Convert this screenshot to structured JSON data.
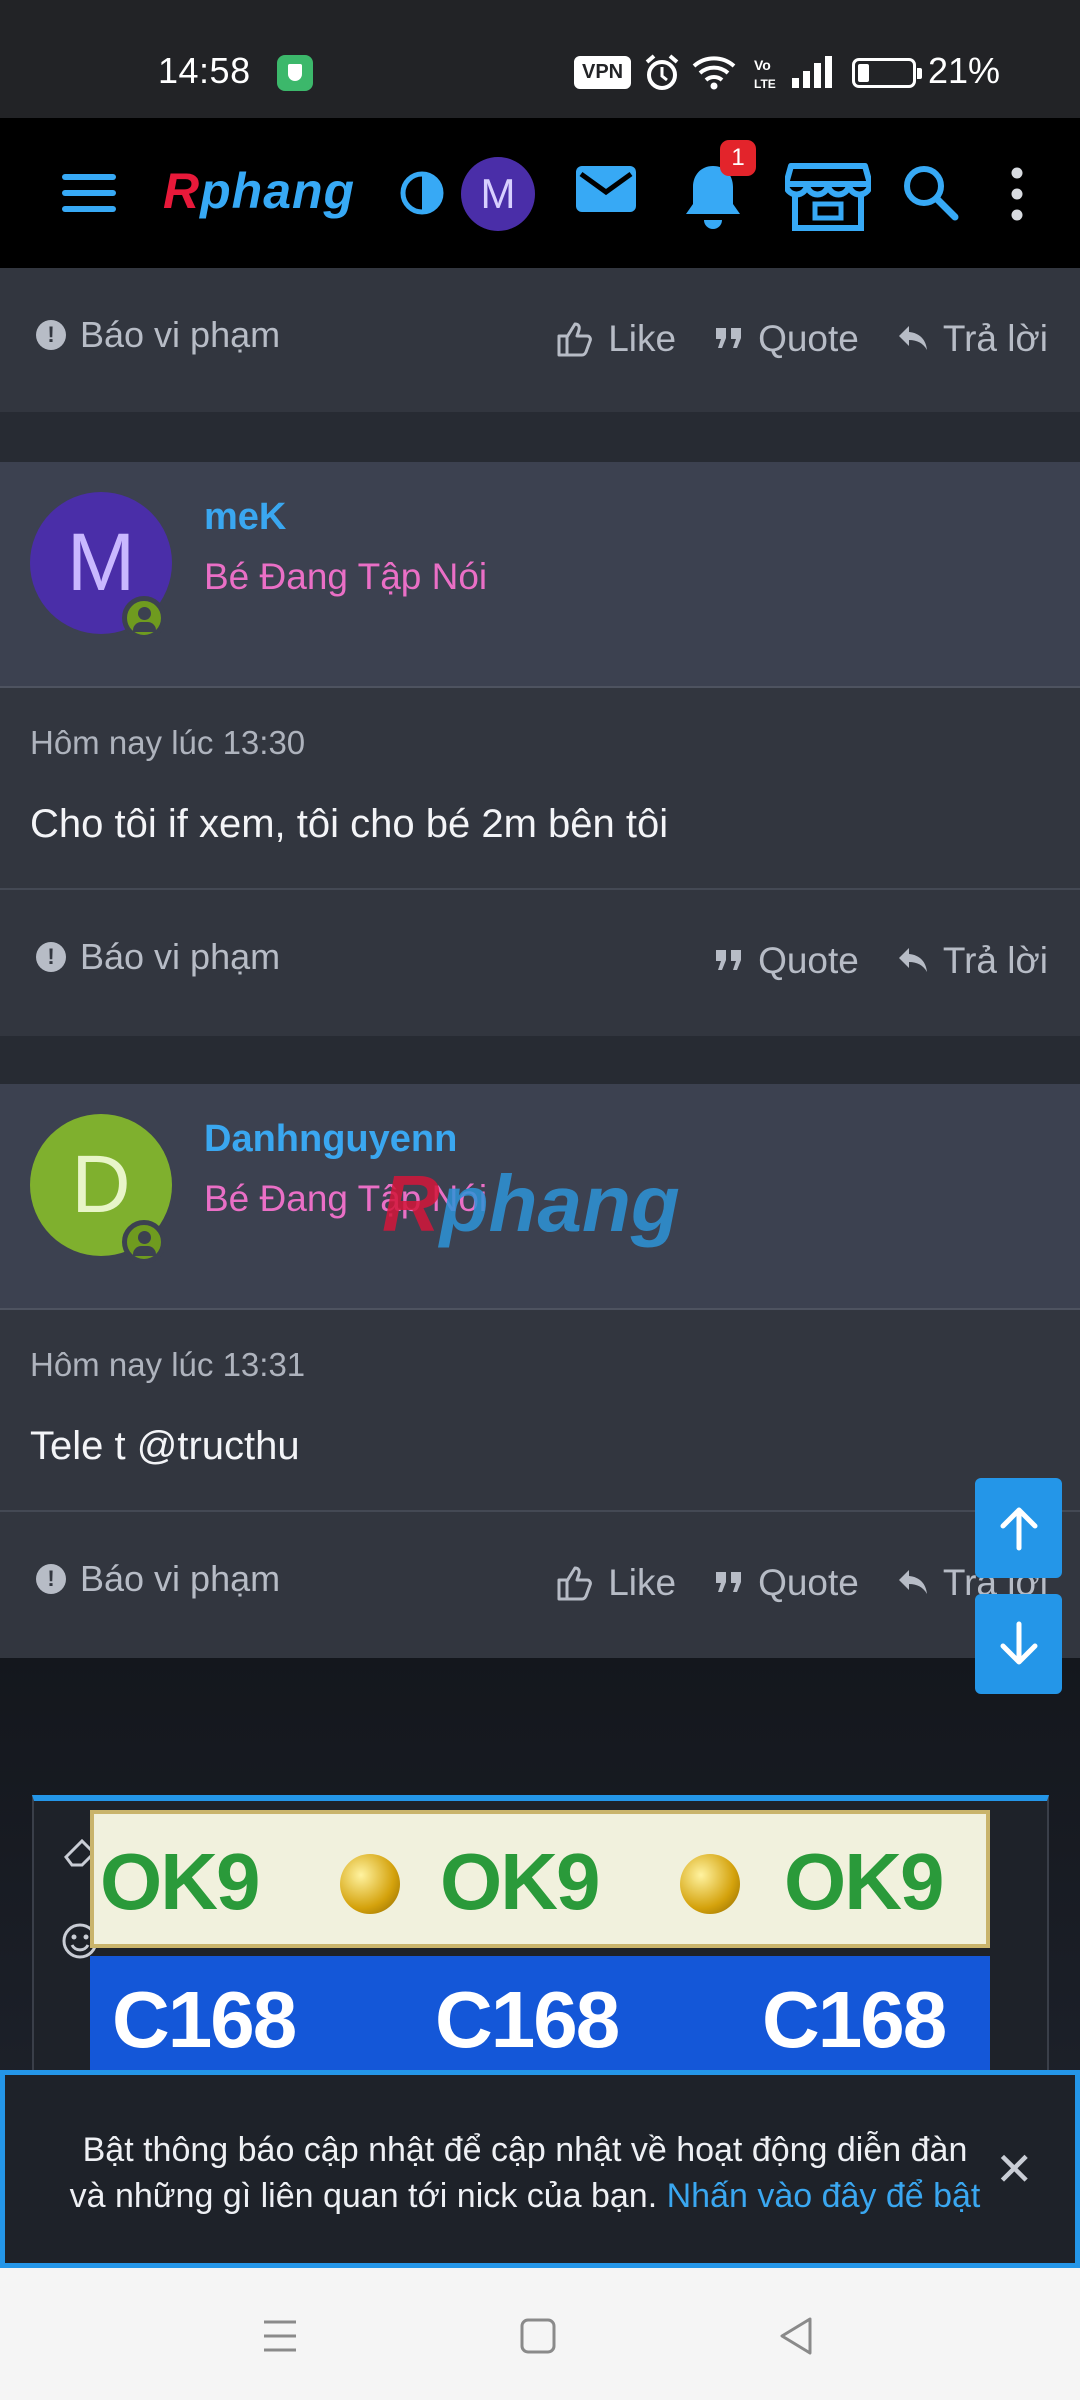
{
  "status_bar": {
    "time": "14:58",
    "vpn": "VPN",
    "battery_percent": "21%",
    "icons": [
      "shield-icon",
      "alarm-icon",
      "wifi-icon",
      "volte-icon",
      "signal-icon",
      "battery-icon"
    ]
  },
  "navbar": {
    "logo_r": "R",
    "logo_rest": "phang",
    "avatar_letter": "M",
    "notification_count": "1",
    "icons": [
      "menu-icon",
      "contrast-icon",
      "mail-icon",
      "bell-icon",
      "store-icon",
      "search-icon",
      "more-vert-icon"
    ]
  },
  "posts": [
    {
      "report_label": "Báo vi phạm",
      "like_label": "Like",
      "quote_label": "Quote",
      "reply_label": "Trả lời"
    },
    {
      "avatar_letter": "M",
      "username": "meK",
      "user_title": "Bé Đang Tập Nói",
      "time": "Hôm nay lúc 13:30",
      "text": "Cho tôi if xem, tôi cho bé 2m bên tôi",
      "report_label": "Báo vi phạm",
      "quote_label": "Quote",
      "reply_label": "Trả lời"
    },
    {
      "avatar_letter": "D",
      "username": "Danhnguyenn",
      "user_title": "Bé Đang Tập Nói",
      "time": "Hôm nay lúc 13:31",
      "text": "Tele t @tructhu",
      "report_label": "Báo vi phạm",
      "like_label": "Like",
      "quote_label": "Quote",
      "reply_label": "Trả lời"
    }
  ],
  "watermark": {
    "r": "R",
    "rest": "phang"
  },
  "ads": {
    "ad1_word": "OK9",
    "ad2_word": "C168"
  },
  "notice": {
    "text": "Bật thông báo cập nhật để cập nhật về hoạt động diễn đàn và những gì liên quan tới nick của bạn.",
    "link": "Nhấn vào đây để bật",
    "close": "✕"
  },
  "colors": {
    "accent": "#2496e8",
    "username": "#3aa7f0",
    "user_title": "#ea6fc6",
    "avatar_m": "#4a2ea8",
    "avatar_d": "#7fb02e"
  }
}
